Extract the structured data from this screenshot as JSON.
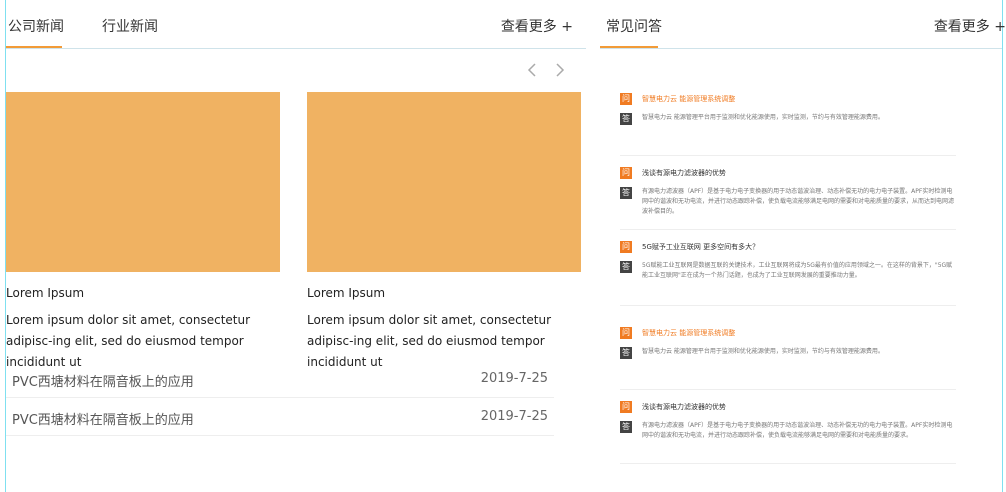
{
  "left": {
    "tabs": [
      {
        "label": "公司新闻",
        "active": true
      },
      {
        "label": "行业新闻",
        "active": false
      }
    ],
    "more": "查看更多 +",
    "cards": [
      {
        "title": "Lorem Ipsum",
        "desc": "Lorem ipsum dolor sit amet, consectetur adipisc-ing elit, sed do eiusmod tempor incididunt ut"
      },
      {
        "title": "Lorem Ipsum",
        "desc": "Lorem ipsum dolor sit amet, consectetur adipisc-ing elit, sed do eiusmod tempor incididunt ut"
      }
    ],
    "news": [
      {
        "title": "PVC西塘材料在隔音板上的应用",
        "date": "2019-7-25"
      },
      {
        "title": "PVC西塘材料在隔音板上的应用",
        "date": "2019-7-25"
      }
    ]
  },
  "right": {
    "title": "常见问答",
    "more": "查看更多 +",
    "q_badge": "问",
    "a_badge": "答",
    "faqs": [
      {
        "q": "智慧电力云 能源管理系统调整",
        "highlight": true,
        "a": "智慧电力云 能源管理平台用于监测和优化能源使用，实时监测，节约与有效管理能源费用。"
      },
      {
        "q": "浅谈有源电力滤波器的优势",
        "highlight": false,
        "a": "有源电力滤波器（APF）是基于电力电子变换器的用于动态谐波治理、动态补偿无功的电力电子装置。APF实时检测电网中的谐波和无功电流，并进行动态跟踪补偿，使负载电流能够满足电网的需要和对电能质量的要求，从而达到电网滤波补偿目的。"
      },
      {
        "q": "5G赋予工业互联网 更多空间有多大？",
        "highlight": false,
        "a": "5G赋能工业互联网是数据互联的关键技术，工业互联网将成为5G最有价值的应用领域之一。在这样的背景下，\"5G赋能工业互联网\"正在成为一个热门话题，也成为了工业互联网发展的重要推动力量。"
      },
      {
        "q": "智慧电力云 能源管理系统调整",
        "highlight": true,
        "a": "智慧电力云 能源管理平台用于监测和优化能源使用，实时监测，节约与有效管理能源费用。"
      },
      {
        "q": "浅谈有源电力滤波器的优势",
        "highlight": false,
        "a": "有源电力滤波器（APF）是基于电力电子变换器的用于动态谐波治理、动态补偿无功的电力电子装置。APF实时检测电网中的谐波和无功电流，并进行动态跟踪补偿，使负载电流能够满足电网的需要和对电能质量的要求。"
      }
    ]
  },
  "colors": {
    "accent": "#f29b38",
    "image_placeholder": "#f0b262",
    "frame": "#7fe0f0"
  },
  "icons": {
    "prev": "chevron-left-icon",
    "next": "chevron-right-icon"
  }
}
